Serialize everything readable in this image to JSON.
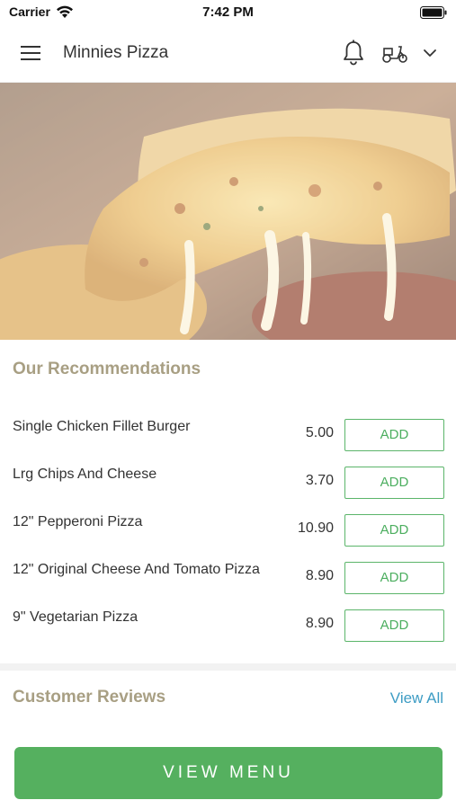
{
  "status_bar": {
    "carrier": "Carrier",
    "time": "7:42 PM"
  },
  "header": {
    "title": "Minnies Pizza"
  },
  "recommendations": {
    "title": "Our Recommendations",
    "add_label": "ADD",
    "items": [
      {
        "name": "Single Chicken Fillet Burger",
        "price": "5.00"
      },
      {
        "name": "Lrg Chips And Cheese",
        "price": "3.70"
      },
      {
        "name": "12\" Pepperoni Pizza",
        "price": "10.90"
      },
      {
        "name": "12\" Original Cheese And Tomato Pizza",
        "price": "8.90"
      },
      {
        "name": "9\" Vegetarian Pizza",
        "price": "8.90"
      }
    ]
  },
  "reviews": {
    "title": "Customer Reviews",
    "view_all": "View All"
  },
  "footer": {
    "view_menu": "VIEW MENU"
  },
  "colors": {
    "accent_green": "#55b05f",
    "link_blue": "#3d9cc4",
    "section_title": "#a89f83"
  }
}
